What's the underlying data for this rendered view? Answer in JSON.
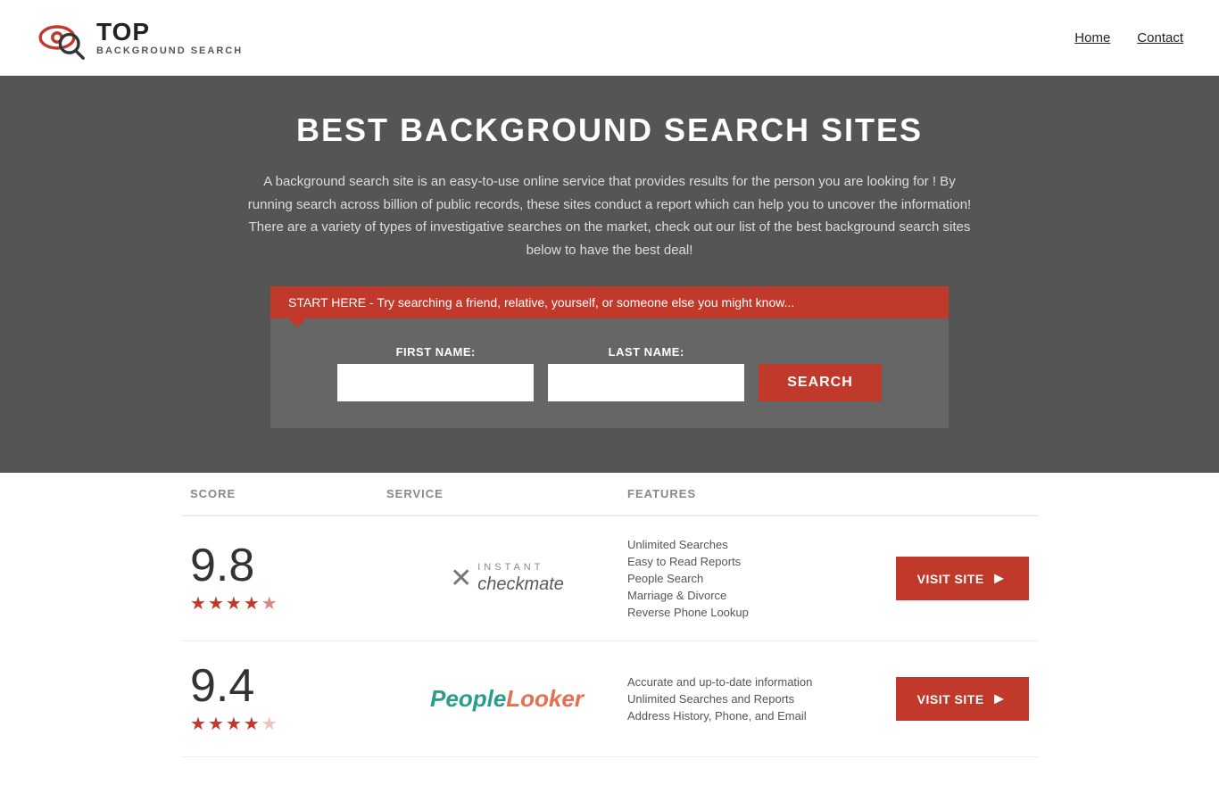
{
  "header": {
    "logo_top": "TOP",
    "logo_bottom": "BACKGROUND SEARCH",
    "nav": [
      {
        "label": "Home",
        "href": "#"
      },
      {
        "label": "Contact",
        "href": "#"
      }
    ]
  },
  "hero": {
    "title": "BEST BACKGROUND SEARCH SITES",
    "description": "A background search site is an easy-to-use online service that provides results  for the person you are looking for ! By  running  search across billion of public records, these sites conduct  a report which can help you to uncover the information! There are a variety of types of investigative searches on the market, check out our  list of the best background search sites below to have the best deal!",
    "banner_text": "START HERE - Try searching a friend, relative, yourself, or someone else you might know...",
    "first_name_label": "FIRST NAME:",
    "last_name_label": "LAST NAME:",
    "search_button": "SEARCH"
  },
  "table": {
    "headers": {
      "score": "SCORE",
      "service": "SERVICE",
      "features": "FEATURES",
      "action": ""
    },
    "rows": [
      {
        "score": "9.8",
        "stars": 4.5,
        "service_name": "Instant Checkmate",
        "service_type": "checkmate",
        "features": [
          "Unlimited Searches",
          "Easy to Read Reports",
          "People Search",
          "Marriage & Divorce",
          "Reverse Phone Lookup"
        ],
        "visit_label": "VISIT SITE"
      },
      {
        "score": "9.4",
        "stars": 4,
        "service_name": "PeopleLooker",
        "service_type": "peoplelooker",
        "features": [
          "Accurate and up-to-date information",
          "Unlimited Searches and Reports",
          "Address History, Phone, and Email"
        ],
        "visit_label": "VISIT SITE"
      }
    ]
  }
}
